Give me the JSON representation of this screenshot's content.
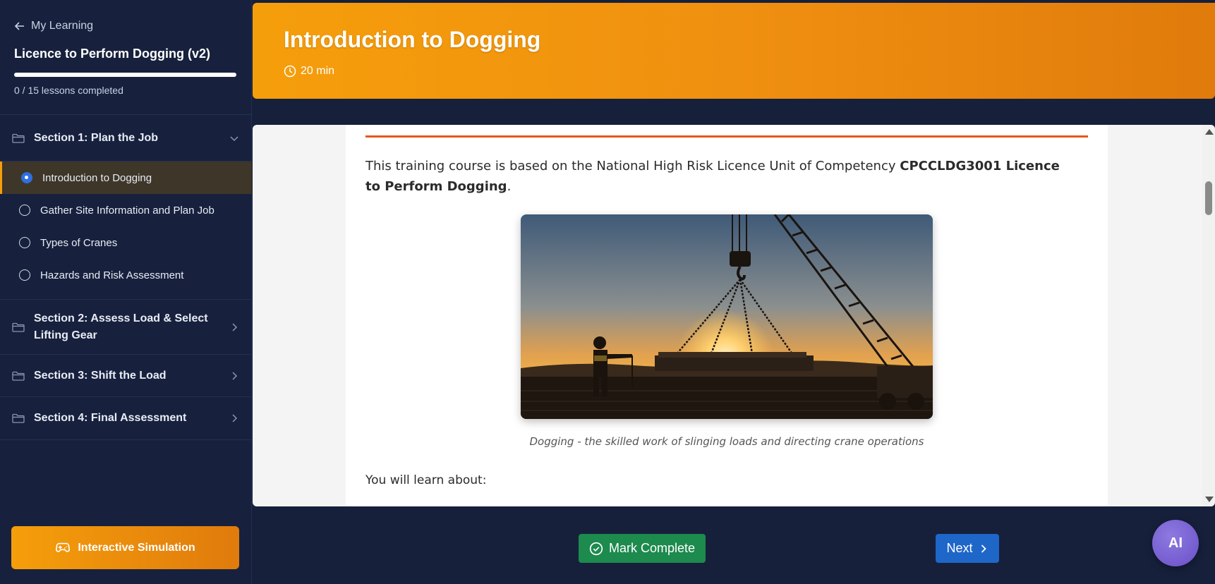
{
  "sidebar": {
    "back_label": "My Learning",
    "course_title": "Licence to Perform Dogging (v2)",
    "progress_fraction": 0,
    "progress_text": "0 / 15 lessons completed",
    "sections": [
      {
        "title": "Section 1: Plan the Job",
        "expanded": true,
        "lessons": [
          {
            "label": "Introduction to Dogging",
            "active": true
          },
          {
            "label": "Gather Site Information and Plan Job",
            "active": false
          },
          {
            "label": "Types of Cranes",
            "active": false
          },
          {
            "label": "Hazards and Risk Assessment",
            "active": false
          }
        ]
      },
      {
        "title": "Section 2: Assess Load & Select Lifting Gear",
        "expanded": false
      },
      {
        "title": "Section 3: Shift the Load",
        "expanded": false
      },
      {
        "title": "Section 4: Final Assessment",
        "expanded": false
      }
    ],
    "simulation_label": "Interactive Simulation"
  },
  "header": {
    "title": "Introduction to Dogging",
    "duration": "20 min"
  },
  "content": {
    "intro_text": "This training course is based on the National High Risk Licence Unit of Competency ",
    "intro_bold": "CPCCLDG3001 Licence to Perform Dogging",
    "intro_end": ".",
    "image_caption": "Dogging - the skilled work of slinging loads and directing crane operations",
    "learn_heading": "You will learn about:"
  },
  "footer": {
    "mark_complete_label": "Mark Complete",
    "next_label": "Next",
    "ai_label": "AI"
  },
  "colors": {
    "accent_orange": "#f59e0b",
    "sidebar_bg": "#17213d",
    "success_green": "#1d8a4e",
    "primary_blue": "#1f66c9",
    "ai_purple": "#7b63d6"
  }
}
